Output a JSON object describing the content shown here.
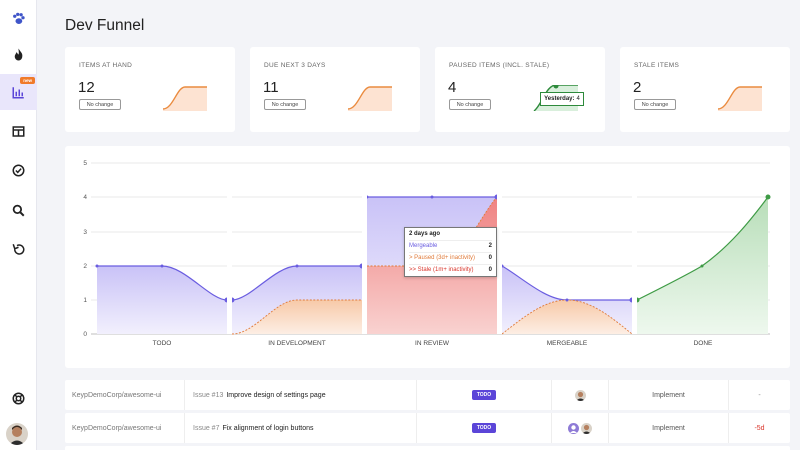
{
  "page": {
    "title": "Dev Funnel"
  },
  "sidebar": {
    "items": [
      {
        "icon": "paw-icon"
      },
      {
        "icon": "flame-icon"
      },
      {
        "icon": "bar-chart-icon",
        "badge": "new",
        "active": true
      },
      {
        "icon": "board-icon"
      },
      {
        "icon": "check-circle-icon"
      },
      {
        "icon": "search-icon"
      },
      {
        "icon": "undo-icon"
      },
      {
        "icon": "lifebuoy-icon"
      }
    ]
  },
  "cards": [
    {
      "label": "ITEMS AT HAND",
      "value": "12",
      "change": "No change"
    },
    {
      "label": "DUE NEXT 3 DAYS",
      "value": "11",
      "change": "No change"
    },
    {
      "label": "PAUSED ITEMS (INCL. STALE)",
      "value": "4",
      "change": "No change",
      "tooltip": {
        "key": "Yesterday:",
        "value": "4"
      }
    },
    {
      "label": "STALE ITEMS",
      "value": "2",
      "change": "No change"
    }
  ],
  "chart_data": {
    "type": "area",
    "categories": [
      "TODO",
      "IN DEVELOPMENT",
      "IN REVIEW",
      "MERGEABLE",
      "DONE"
    ],
    "ylim": [
      0,
      5
    ],
    "yticks": [
      "0",
      "1",
      "2",
      "3",
      "4",
      "5"
    ],
    "tooltip": {
      "title": "2 days ago",
      "rows": [
        {
          "label": "Mergeable",
          "value": "2",
          "color": "#6a5de0"
        },
        {
          "label": "> Paused (3d+ inactivity)",
          "value": "0",
          "color": "#e07b3a"
        },
        {
          "label": ">> Stale (1m+ inactivity)",
          "value": "0",
          "color": "#d9352b"
        }
      ]
    },
    "colors": {
      "count": "#7b6cf0",
      "paused": "#e9a06a",
      "review": "#ef7b7b",
      "done": "#4caf50"
    }
  },
  "table": {
    "rows": [
      {
        "repo": "KeypDemoCorp/awesome-ui",
        "issue_num": "Issue #13",
        "issue_title": "Improve design of settings page",
        "status": "TODO",
        "step": "Implement",
        "due": "-"
      },
      {
        "repo": "KeypDemoCorp/awesome-ui",
        "issue_num": "Issue #7",
        "issue_title": "Fix alignment of login buttons",
        "status": "TODO",
        "step": "Implement",
        "due": "-5d"
      }
    ]
  }
}
